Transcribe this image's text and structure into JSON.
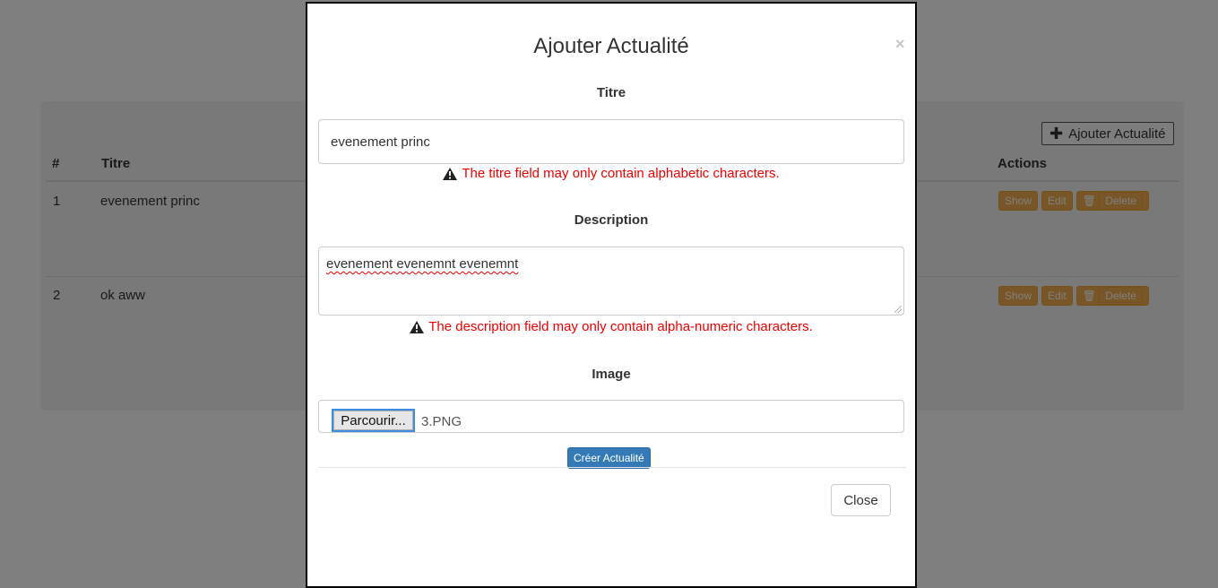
{
  "background": {
    "add_button_label": "Ajouter Actualité",
    "table": {
      "headers": {
        "index": "#",
        "title": "Titre",
        "actions": "Actions"
      },
      "rows": [
        {
          "index": "1",
          "title": "evenement princ"
        },
        {
          "index": "2",
          "title": "ok aww"
        }
      ],
      "actions": {
        "show": "Show",
        "edit": "Edit",
        "delete": "Delete"
      }
    }
  },
  "modal": {
    "title": "Ajouter Actualité",
    "close_symbol": "×",
    "fields": {
      "titre": {
        "label": "Titre",
        "value": "evenement princ",
        "error": "The titre field may only contain alphabetic characters."
      },
      "description": {
        "label": "Description",
        "value": "evenement evenemnt evenemnt",
        "error": "The description field may only contain alpha-numeric characters."
      },
      "image": {
        "label": "Image",
        "browse_label": "Parcourir...",
        "file_name": "3.PNG"
      }
    },
    "submit_label": "Créer Actualité",
    "close_label": "Close"
  },
  "colors": {
    "primary": "#337ab7",
    "warning": "#f0ad4e",
    "error": "#ee0000"
  }
}
